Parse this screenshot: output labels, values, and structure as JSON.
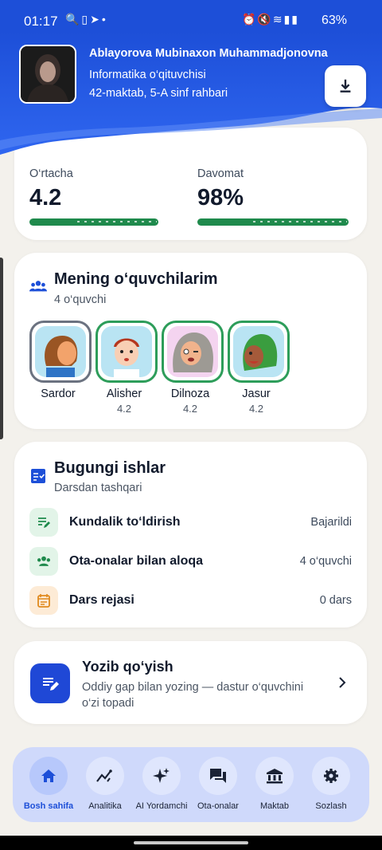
{
  "status_bar": {
    "time": "01:17",
    "battery": "63%"
  },
  "header": {
    "name": "Ablayorova Mubinaxon Muhammadjonovna",
    "role": "Informatika o‘qituvchisi",
    "school": "42-maktab, 5-A sinf rahbari"
  },
  "stats": {
    "average_label": "O‘rtacha",
    "average_value": "4.2",
    "attendance_label": "Davomat",
    "attendance_value": "98%"
  },
  "students_card": {
    "title": "Mening o‘quvchilarim",
    "subtitle": "4 o‘quvchi",
    "students": [
      {
        "name": "Sardor",
        "grade": ""
      },
      {
        "name": "Alisher",
        "grade": "4.2"
      },
      {
        "name": "Dilnoza",
        "grade": "4.2"
      },
      {
        "name": "Jasur",
        "grade": "4.2"
      }
    ]
  },
  "tasks_card": {
    "title": "Bugungi ishlar",
    "subtitle": "Darsdan tashqari",
    "tasks": [
      {
        "label": "Kundalik to‘ldirish",
        "value": "Bajarildi",
        "icon": "edit-note-icon"
      },
      {
        "label": "Ota-onalar bilan aloqa",
        "value": "4 o‘quvchi",
        "icon": "group-icon"
      },
      {
        "label": "Dars rejasi",
        "value": "0 dars",
        "icon": "calendar-icon"
      }
    ]
  },
  "quick_add": {
    "title": "Yozib qo‘yish",
    "description_line1": "Oddiy gap bilan yozing — dastur o‘quvchini",
    "description_line2": "o‘zi topadi"
  },
  "bottom_nav": {
    "items": [
      {
        "label": "Bosh sahifa",
        "icon": "home-icon"
      },
      {
        "label": "Analitika",
        "icon": "analytics-icon"
      },
      {
        "label": "AI Yordamchi",
        "icon": "sparkle-icon"
      },
      {
        "label": "Ota-onalar",
        "icon": "chat-icon"
      },
      {
        "label": "Maktab",
        "icon": "bank-icon"
      },
      {
        "label": "Sozlash",
        "icon": "gear-icon"
      }
    ]
  },
  "colors": {
    "primary": "#1d4fd8",
    "success": "#1f8a4c",
    "background": "#f3f1ec"
  }
}
